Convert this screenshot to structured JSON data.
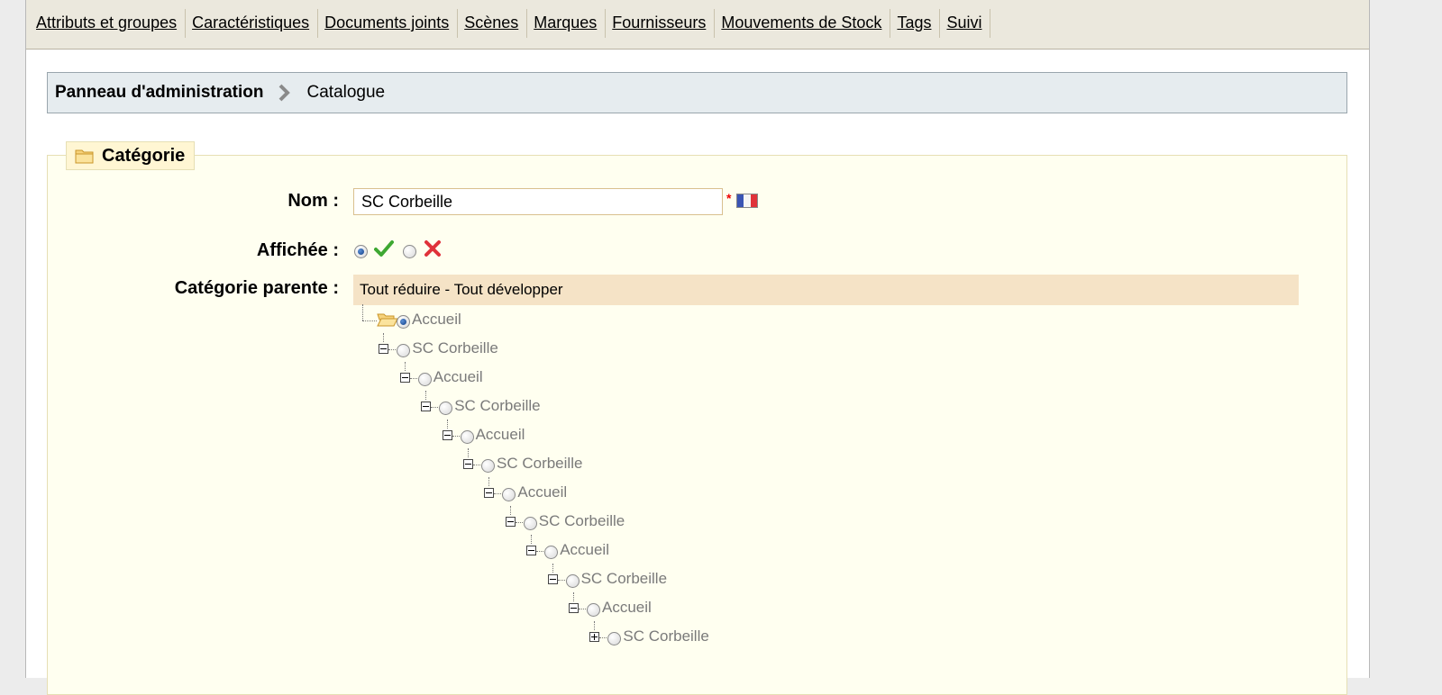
{
  "tabs": [
    "Attributs et groupes",
    "Caractéristiques",
    "Documents joints",
    "Scènes",
    "Marques",
    "Fournisseurs",
    "Mouvements de Stock",
    "Tags",
    "Suivi"
  ],
  "breadcrumb": {
    "home": "Panneau d'administration",
    "current": "Catalogue"
  },
  "fieldset": {
    "legend": "Catégorie"
  },
  "form": {
    "name_label": "Nom :",
    "name_value": "SC Corbeille",
    "required_mark": "*",
    "displayed_label": "Affichée :",
    "displayed_value": "yes",
    "parent_label": "Catégorie parente :"
  },
  "tree": {
    "collapse_all": "Tout réduire",
    "separator": " - ",
    "expand_all": "Tout développer",
    "selected": "Accueil",
    "nodes": [
      {
        "label": "Accueil",
        "selected": true,
        "toggle": "folder"
      },
      {
        "label": "SC Corbeille",
        "toggle": "minus"
      },
      {
        "label": "Accueil",
        "toggle": "minus"
      },
      {
        "label": "SC Corbeille",
        "toggle": "minus"
      },
      {
        "label": "Accueil",
        "toggle": "minus"
      },
      {
        "label": "SC Corbeille",
        "toggle": "minus"
      },
      {
        "label": "Accueil",
        "toggle": "minus"
      },
      {
        "label": "SC Corbeille",
        "toggle": "minus"
      },
      {
        "label": "Accueil",
        "toggle": "minus"
      },
      {
        "label": "SC Corbeille",
        "toggle": "minus"
      },
      {
        "label": "Accueil",
        "toggle": "minus"
      },
      {
        "label": "SC Corbeille",
        "toggle": "plus"
      }
    ]
  },
  "icons": {
    "yes_icon": "check-icon",
    "no_icon": "cross-icon",
    "legend_icon": "folder-icon",
    "language_icon": "french-flag-icon",
    "breadcrumb_separator": "chevron-right-icon"
  },
  "colors": {
    "yes": "#3ea832",
    "no": "#e0323a",
    "tree_header": "#f5e3c6",
    "fieldset_bg": "#fffff0"
  }
}
